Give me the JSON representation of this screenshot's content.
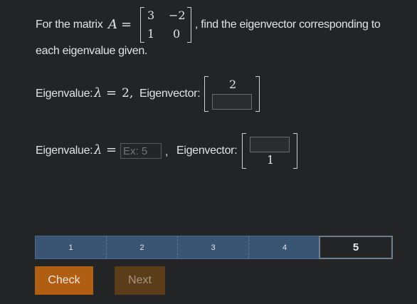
{
  "question": {
    "prefix": "For the matrix",
    "var": "A",
    "eq": "=",
    "matrix": [
      [
        "3",
        "−2"
      ],
      [
        "1",
        "0"
      ]
    ],
    "suffix": ", find the eigenvector corresponding to",
    "line2": "each eigenvalue given."
  },
  "row1": {
    "label": "Eigenvalue:",
    "lambda": "λ",
    "eq": "=",
    "value": "2,",
    "vec_label": "Eigenvector:",
    "vec_top": "2"
  },
  "row2": {
    "label": "Eigenvalue:",
    "lambda": "λ",
    "eq": "=",
    "input_placeholder": "Ex: 5",
    "comma": ",",
    "vec_label": "Eigenvector:",
    "vec_bottom": "1"
  },
  "progress": {
    "steps": [
      "1",
      "2",
      "3",
      "4",
      "5"
    ],
    "active_step": "5"
  },
  "buttons": {
    "check": "Check",
    "next": "Next"
  },
  "colors": {
    "check_bg": "#b15e15",
    "next_bg": "#5c3d1a",
    "progress_bg": "#3a5573"
  }
}
